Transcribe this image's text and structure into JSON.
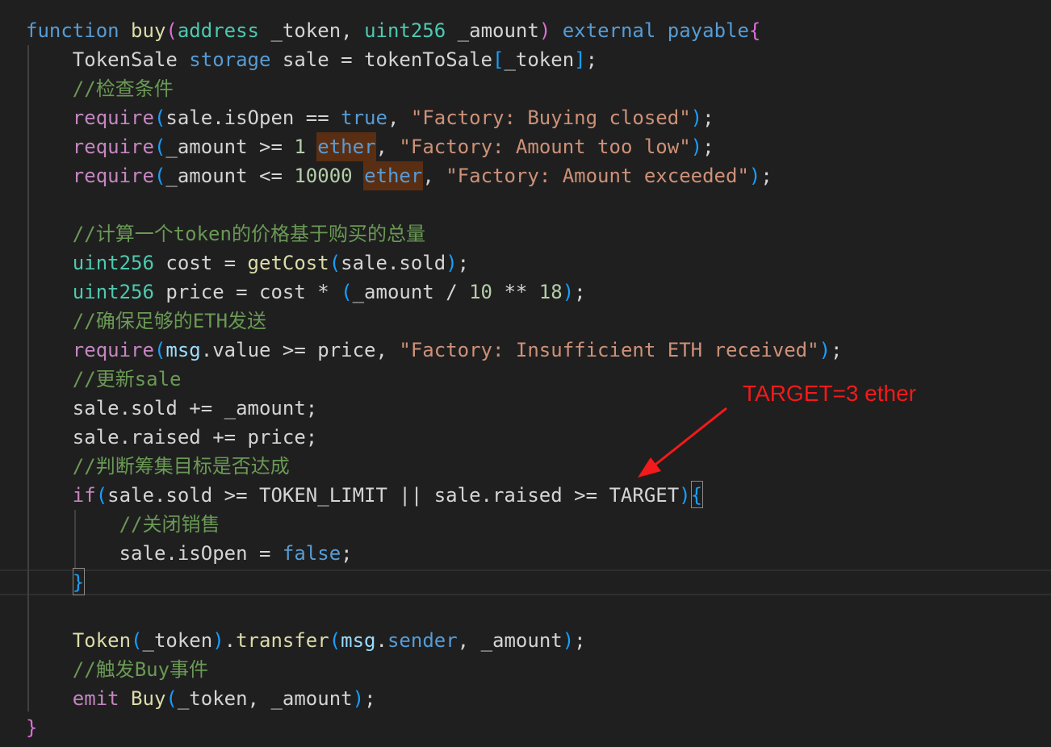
{
  "code": {
    "lines": [
      [
        {
          "t": "function",
          "c": "k"
        },
        {
          "t": " "
        },
        {
          "t": "buy",
          "c": "f"
        },
        {
          "t": "(",
          "c": "p2"
        },
        {
          "t": "address",
          "c": "t"
        },
        {
          "t": " _token, "
        },
        {
          "t": "uint256",
          "c": "t"
        },
        {
          "t": " _amount"
        },
        {
          "t": ")",
          "c": "p2"
        },
        {
          "t": " "
        },
        {
          "t": "external",
          "c": "k"
        },
        {
          "t": " "
        },
        {
          "t": "payable",
          "c": "k"
        },
        {
          "t": "{",
          "c": "p2"
        }
      ],
      [
        {
          "t": "    TokenSale "
        },
        {
          "t": "storage",
          "c": "k"
        },
        {
          "t": " sale = tokenToSale"
        },
        {
          "t": "[",
          "c": "p3"
        },
        {
          "t": "_token"
        },
        {
          "t": "]",
          "c": "p3"
        },
        {
          "t": ";"
        }
      ],
      [
        {
          "t": "    //检查条件",
          "c": "c"
        }
      ],
      [
        {
          "t": "    "
        },
        {
          "t": "require",
          "c": "kp"
        },
        {
          "t": "(",
          "c": "p3"
        },
        {
          "t": "sale.isOpen == "
        },
        {
          "t": "true",
          "c": "k"
        },
        {
          "t": ", "
        },
        {
          "t": "\"Factory: Buying closed\"",
          "c": "s"
        },
        {
          "t": ")",
          "c": "p3"
        },
        {
          "t": ";"
        }
      ],
      [
        {
          "t": "    "
        },
        {
          "t": "require",
          "c": "kp"
        },
        {
          "t": "(",
          "c": "p3"
        },
        {
          "t": "_amount >= "
        },
        {
          "t": "1",
          "c": "n"
        },
        {
          "t": " "
        },
        {
          "t": "ether",
          "c": "k"
        },
        {
          "t": ", "
        },
        {
          "t": "\"Factory: Amount too low\"",
          "c": "s"
        },
        {
          "t": ")",
          "c": "p3"
        },
        {
          "t": ";"
        }
      ],
      [
        {
          "t": "    "
        },
        {
          "t": "require",
          "c": "kp"
        },
        {
          "t": "(",
          "c": "p3"
        },
        {
          "t": "_amount <= "
        },
        {
          "t": "10000",
          "c": "n"
        },
        {
          "t": " "
        },
        {
          "t": "ether",
          "c": "k"
        },
        {
          "t": ", "
        },
        {
          "t": "\"Factory: Amount exceeded\"",
          "c": "s"
        },
        {
          "t": ")",
          "c": "p3"
        },
        {
          "t": ";"
        }
      ],
      [],
      [
        {
          "t": "    //计算一个token的价格基于购买的总量",
          "c": "c"
        }
      ],
      [
        {
          "t": "    "
        },
        {
          "t": "uint256",
          "c": "t"
        },
        {
          "t": " cost = "
        },
        {
          "t": "getCost",
          "c": "f"
        },
        {
          "t": "(",
          "c": "p3"
        },
        {
          "t": "sale.sold"
        },
        {
          "t": ")",
          "c": "p3"
        },
        {
          "t": ";"
        }
      ],
      [
        {
          "t": "    "
        },
        {
          "t": "uint256",
          "c": "t"
        },
        {
          "t": " price = cost * "
        },
        {
          "t": "(",
          "c": "p3"
        },
        {
          "t": "_amount / "
        },
        {
          "t": "10",
          "c": "n"
        },
        {
          "t": " ** "
        },
        {
          "t": "18",
          "c": "n"
        },
        {
          "t": ")",
          "c": "p3"
        },
        {
          "t": ";"
        }
      ],
      [
        {
          "t": "    //确保足够的ETH发送",
          "c": "c"
        }
      ],
      [
        {
          "t": "    "
        },
        {
          "t": "require",
          "c": "kp"
        },
        {
          "t": "(",
          "c": "p3"
        },
        {
          "t": "msg",
          "c": "v"
        },
        {
          "t": ".value >= price, "
        },
        {
          "t": "\"Factory: Insufficient ETH received\"",
          "c": "s"
        },
        {
          "t": ")",
          "c": "p3"
        },
        {
          "t": ";"
        }
      ],
      [
        {
          "t": "    //更新sale",
          "c": "c"
        }
      ],
      [
        {
          "t": "    sale.sold += _amount;"
        }
      ],
      [
        {
          "t": "    sale.raised += price;"
        }
      ],
      [
        {
          "t": "    //判断筹集目标是否达成",
          "c": "c"
        }
      ],
      [
        {
          "t": "    "
        },
        {
          "t": "if",
          "c": "kp"
        },
        {
          "t": "(",
          "c": "p3"
        },
        {
          "t": "sale.sold >= TOKEN_LIMIT || sale.raised >= TARGET"
        },
        {
          "t": ")",
          "c": "p3"
        },
        {
          "t": "{",
          "c": "p3"
        }
      ],
      [
        {
          "t": "        //关闭销售",
          "c": "c"
        }
      ],
      [
        {
          "t": "        sale.isOpen = "
        },
        {
          "t": "false",
          "c": "k"
        },
        {
          "t": ";"
        }
      ],
      [
        {
          "t": "    "
        },
        {
          "t": "}",
          "c": "p3"
        }
      ],
      [],
      [
        {
          "t": "    "
        },
        {
          "t": "Token",
          "c": "f"
        },
        {
          "t": "(",
          "c": "p3"
        },
        {
          "t": "_token"
        },
        {
          "t": ")",
          "c": "p3"
        },
        {
          "t": "."
        },
        {
          "t": "transfer",
          "c": "f"
        },
        {
          "t": "(",
          "c": "p3"
        },
        {
          "t": "msg",
          "c": "v"
        },
        {
          "t": "."
        },
        {
          "t": "sender",
          "c": "k"
        },
        {
          "t": ", _amount"
        },
        {
          "t": ")",
          "c": "p3"
        },
        {
          "t": ";"
        }
      ],
      [
        {
          "t": "    //触发Buy事件",
          "c": "c"
        }
      ],
      [
        {
          "t": "    "
        },
        {
          "t": "emit",
          "c": "kp"
        },
        {
          "t": " "
        },
        {
          "t": "Buy",
          "c": "f"
        },
        {
          "t": "(",
          "c": "p3"
        },
        {
          "t": "_token, _amount"
        },
        {
          "t": ")",
          "c": "p3"
        },
        {
          "t": ";"
        }
      ],
      [
        {
          "t": "}",
          "c": "p2"
        }
      ]
    ]
  },
  "annotation": {
    "text": "TARGET=3 ether",
    "color": "#f21a1a"
  }
}
